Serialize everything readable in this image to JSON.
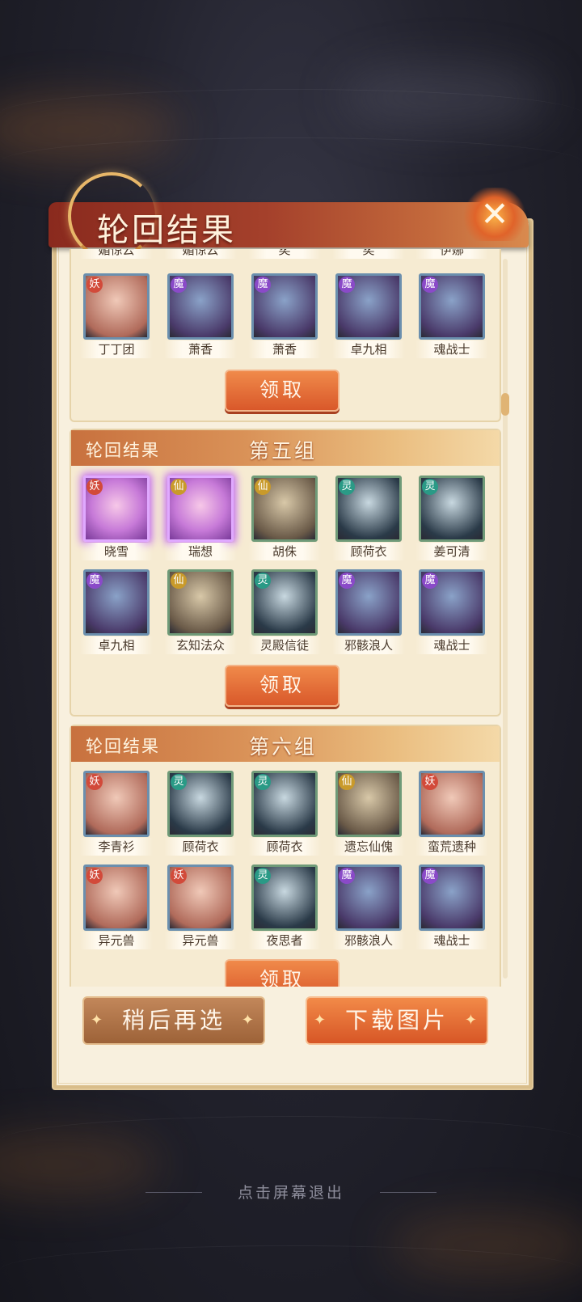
{
  "title": "轮回结果",
  "close_symbol": "✕",
  "top_partial_names": [
    "媚惊云",
    "媚惊云",
    "奕",
    "奕",
    "伊娜"
  ],
  "group_prev": {
    "heroes": [
      {
        "name": "丁丁团",
        "tag": "妖"
      },
      {
        "name": "萧香",
        "tag": "魔"
      },
      {
        "name": "萧香",
        "tag": "魔"
      },
      {
        "name": "卓九相",
        "tag": "魔"
      },
      {
        "name": "魂战士",
        "tag": "魔"
      }
    ],
    "claim_label": "领取"
  },
  "group5": {
    "label": "轮回结果",
    "group_name": "第五组",
    "heroes": [
      {
        "name": "晓雪",
        "tag": "妖"
      },
      {
        "name": "瑞想",
        "tag": "仙"
      },
      {
        "name": "胡侏",
        "tag": "仙"
      },
      {
        "name": "顾荷衣",
        "tag": "灵"
      },
      {
        "name": "姜可清",
        "tag": "灵"
      },
      {
        "name": "卓九相",
        "tag": "魔"
      },
      {
        "name": "玄知法众",
        "tag": "仙"
      },
      {
        "name": "灵殿信徒",
        "tag": "灵"
      },
      {
        "name": "邪骸浪人",
        "tag": "魔"
      },
      {
        "name": "魂战士",
        "tag": "魔"
      }
    ],
    "claim_label": "领取"
  },
  "group6": {
    "label": "轮回结果",
    "group_name": "第六组",
    "heroes": [
      {
        "name": "李青衫",
        "tag": "妖"
      },
      {
        "name": "顾荷衣",
        "tag": "灵"
      },
      {
        "name": "顾荷衣",
        "tag": "灵"
      },
      {
        "name": "遗忘仙傀",
        "tag": "仙"
      },
      {
        "name": "蛮荒遗种",
        "tag": "妖"
      },
      {
        "name": "异元兽",
        "tag": "妖"
      },
      {
        "name": "异元兽",
        "tag": "妖"
      },
      {
        "name": "夜思者",
        "tag": "灵"
      },
      {
        "name": "邪骸浪人",
        "tag": "魔"
      },
      {
        "name": "魂战士",
        "tag": "魔"
      }
    ],
    "claim_label": "领取"
  },
  "buttons": {
    "later": "稍后再选",
    "download": "下载图片"
  },
  "exit_hint": "点击屏幕退出"
}
